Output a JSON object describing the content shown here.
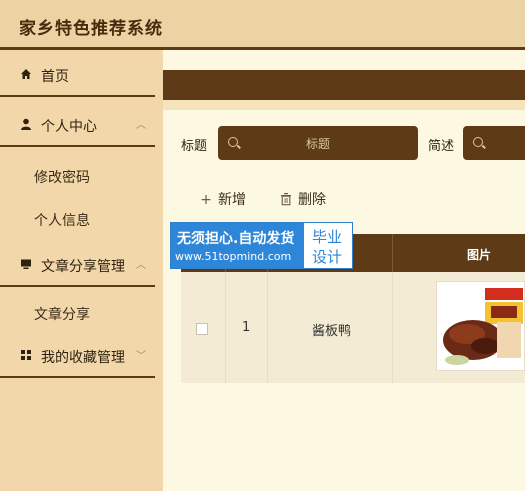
{
  "app": {
    "title": "家乡特色推荐系统"
  },
  "sidebar": {
    "items": [
      {
        "label": "首页",
        "icon": "home-icon"
      },
      {
        "label": "个人中心",
        "icon": "user-icon",
        "expanded": true,
        "children": [
          {
            "label": "修改密码"
          },
          {
            "label": "个人信息"
          }
        ]
      },
      {
        "label": "文章分享管理",
        "icon": "monitor-icon",
        "expanded": true,
        "children": [
          {
            "label": "文章分享"
          }
        ]
      },
      {
        "label": "我的收藏管理",
        "icon": "grid-icon",
        "expanded": false
      }
    ]
  },
  "search": {
    "title_label": "标题",
    "title_placeholder": "标题",
    "summary_label": "简述",
    "summary_placeholder": ""
  },
  "toolbar": {
    "add_label": "新增",
    "delete_label": "删除"
  },
  "table": {
    "headers": [
      "",
      "",
      "",
      "图片"
    ],
    "rows": [
      {
        "index": "1",
        "title": "酱板鸭",
        "image": "duck-product-image"
      }
    ]
  },
  "watermark": {
    "line1": "无须担心.自动发货",
    "line2": "www.51topmind.com",
    "right1": "毕业",
    "right2": "设计"
  },
  "colors": {
    "dark_brown": "#5e3a16",
    "sidebar": "#f1d7a9",
    "page_bg": "#fdf8e2",
    "watermark_blue": "#2e86d8"
  }
}
